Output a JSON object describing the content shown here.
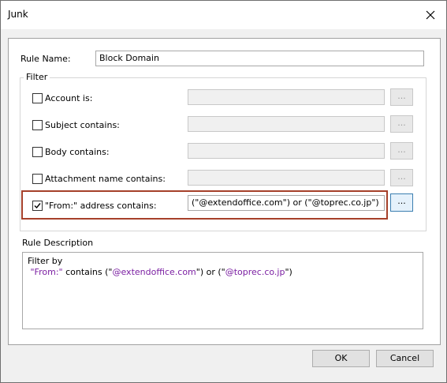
{
  "window": {
    "title": "Junk",
    "close_icon": "close-icon"
  },
  "rule_name": {
    "label": "Rule Name:",
    "value": "Block Domain"
  },
  "filter": {
    "title": "Filter",
    "rows": [
      {
        "label": "Account is:",
        "checked": false,
        "value": "",
        "button": "..."
      },
      {
        "label": "Subject contains:",
        "checked": false,
        "value": "",
        "button": "..."
      },
      {
        "label": "Body contains:",
        "checked": false,
        "value": "",
        "button": "..."
      },
      {
        "label": "Attachment name contains:",
        "checked": false,
        "value": "",
        "button": "..."
      },
      {
        "label": "\"From:\" address contains:",
        "checked": true,
        "value": "(\"@extendoffice.com\") or (\"@toprec.co.jp\")",
        "button": "..."
      }
    ]
  },
  "description": {
    "title": "Rule Description",
    "line1": "Filter by",
    "from_label": "\"From:\"",
    "contains_text": " contains (\"",
    "domain1": "@extendoffice.com",
    "or_text": "\") or (\"",
    "domain2": "@toprec.co.jp",
    "end_text": "\")"
  },
  "buttons": {
    "ok": "OK",
    "cancel": "Cancel"
  },
  "colors": {
    "highlight": "#a6402a",
    "accent_purple": "#7b1fa2"
  }
}
